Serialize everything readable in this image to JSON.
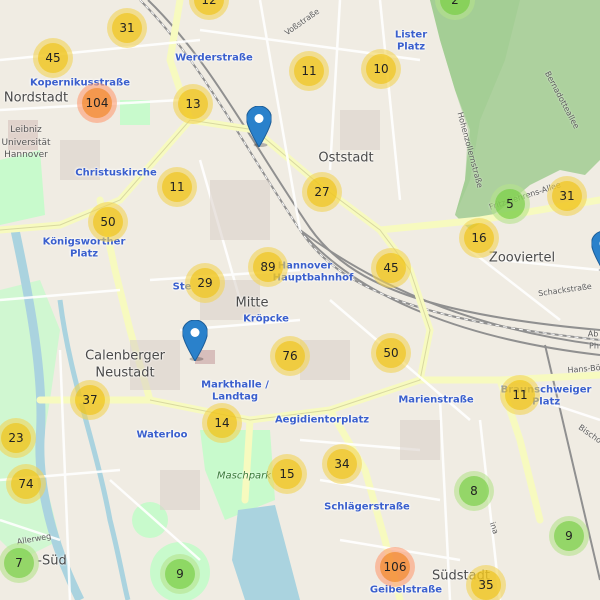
{
  "colors": {
    "small_outer": "rgba(181,226,140,0.6)",
    "small_inner": "rgba(110,204,57,0.6)",
    "medium_outer": "rgba(241,211,87,0.6)",
    "medium_inner": "rgba(240,194,12,0.6)",
    "large_outer": "rgba(253,156,115,0.6)",
    "large_inner": "rgba(241,128,23,0.6)",
    "marker": "#2a81cb"
  },
  "labels": {
    "nordstadt": "Nordstadt",
    "oststadt": "Oststadt",
    "zooviertel": "Zooviertel",
    "mitte": "Mitte",
    "calenberger_1": "Calenberger",
    "calenberger_2": "Neustadt",
    "suedstadt": "Südstadt",
    "sued": "-Süd",
    "kopernikus": "Kopernikusstraße",
    "werder": "Werderstraße",
    "lister_1": "Lister",
    "lister_2": "Platz",
    "christus": "Christuskirche",
    "koenigsworther_1": "Königsworther",
    "koenigsworther_2": "Platz",
    "hbf_1": "Hannover",
    "hbf_2": "Hauptbahnhof",
    "steintor": "Ste",
    "kroepcke": "Kröpcke",
    "markthalle_1": "Markthalle /",
    "markthalle_2": "Landtag",
    "aegidientor": "Aegidientorplatz",
    "marien": "Marienstraße",
    "braunschweiger_1": "Braunschweiger",
    "braunschweiger_2": "Platz",
    "waterloo": "Waterloo",
    "schlaeger": "Schlägerstraße",
    "geibel": "Geibelstraße",
    "maschpark": "Maschpark",
    "leibniz_1": "Leibniz",
    "leibniz_2": "Universität",
    "leibniz_3": "Hannover",
    "vossstr": "Voßstraße",
    "hohenzollern": "Hohenzollernstraße",
    "bernadotte": "Bernadotteallee",
    "fritz": "Fritz-Behrens-Allee",
    "schack": "Schackstraße",
    "hans": "Hans-Bö",
    "bischof": "Bischo",
    "allerweg": "Allerweg",
    "ab": "Ab",
    "ph": "Ph",
    "ina": "ina"
  },
  "clusters": [
    {
      "count": "31",
      "size": "medium"
    },
    {
      "count": "45",
      "size": "medium"
    },
    {
      "count": "104",
      "size": "large"
    },
    {
      "count": "13",
      "size": "medium"
    },
    {
      "count": "11",
      "size": "medium"
    },
    {
      "count": "10",
      "size": "medium"
    },
    {
      "count": "27",
      "size": "medium"
    },
    {
      "count": "5",
      "size": "small"
    },
    {
      "count": "31",
      "size": "medium"
    },
    {
      "count": "16",
      "size": "medium"
    },
    {
      "count": "11",
      "size": "medium"
    },
    {
      "count": "50",
      "size": "medium"
    },
    {
      "count": "89",
      "size": "medium"
    },
    {
      "count": "29",
      "size": "medium"
    },
    {
      "count": "45",
      "size": "medium"
    },
    {
      "count": "76",
      "size": "medium"
    },
    {
      "count": "50",
      "size": "medium"
    },
    {
      "count": "37",
      "size": "medium"
    },
    {
      "count": "11",
      "size": "medium"
    },
    {
      "count": "23",
      "size": "medium"
    },
    {
      "count": "14",
      "size": "medium"
    },
    {
      "count": "74",
      "size": "medium"
    },
    {
      "count": "15",
      "size": "medium"
    },
    {
      "count": "34",
      "size": "medium"
    },
    {
      "count": "8",
      "size": "small"
    },
    {
      "count": "9",
      "size": "small"
    },
    {
      "count": "7",
      "size": "small"
    },
    {
      "count": "9",
      "size": "small"
    },
    {
      "count": "106",
      "size": "large"
    },
    {
      "count": "35",
      "size": "medium"
    },
    {
      "count": "12",
      "size": "medium"
    },
    {
      "count": "2",
      "size": "small"
    }
  ],
  "markers": [
    "marker",
    "marker",
    "marker"
  ]
}
